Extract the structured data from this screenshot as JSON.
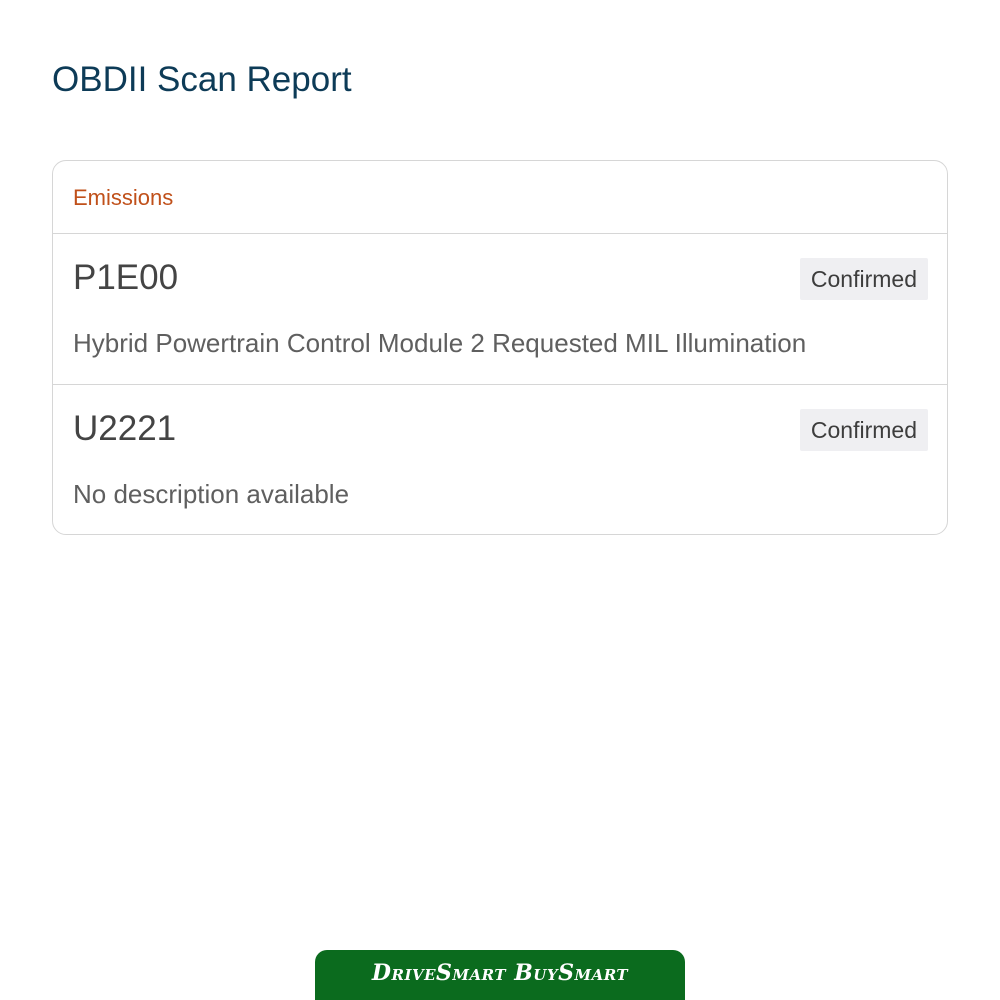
{
  "page": {
    "title": "OBDII Scan Report"
  },
  "report": {
    "category": "Emissions",
    "codes": [
      {
        "code": "P1E00",
        "status": "Confirmed",
        "description": "Hybrid Powertrain Control Module 2 Requested MIL Illumination"
      },
      {
        "code": "U2221",
        "status": "Confirmed",
        "description": "No description available"
      }
    ]
  },
  "footer": {
    "logo_text": "DriveSmart BuySmart"
  },
  "colors": {
    "title": "#0d3b57",
    "category": "#c0501a",
    "badge_bg": "#efeff2",
    "logo_bg": "#0b6b1e"
  }
}
